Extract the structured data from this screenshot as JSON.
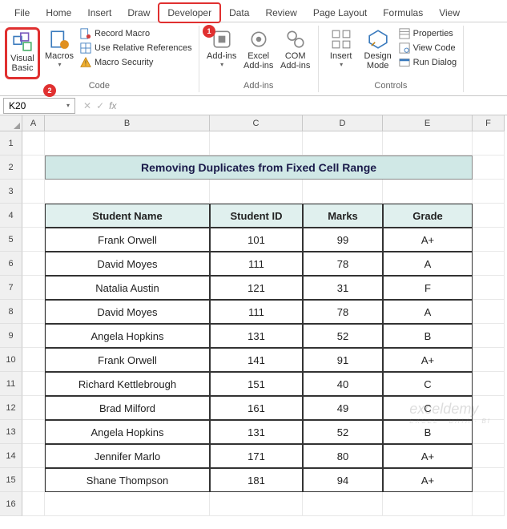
{
  "tabs": [
    "File",
    "Home",
    "Insert",
    "Draw",
    "Developer",
    "Data",
    "Review",
    "Page Layout",
    "Formulas",
    "View"
  ],
  "active_tab_index": 4,
  "ribbon": {
    "code": {
      "label": "Code",
      "visual_basic": "Visual Basic",
      "macros": "Macros",
      "record_macro": "Record Macro",
      "use_rel_refs": "Use Relative References",
      "macro_security": "Macro Security"
    },
    "addins": {
      "label": "Add-ins",
      "addins": "Add-ins",
      "excel_addins": "Excel Add-ins",
      "com_addins": "COM Add-ins"
    },
    "controls": {
      "label": "Controls",
      "insert": "Insert",
      "design_mode": "Design Mode",
      "properties": "Properties",
      "view_code": "View Code",
      "run_dialog": "Run Dialog"
    }
  },
  "namebox": "K20",
  "fx_label": "fx",
  "col_headers": [
    "A",
    "B",
    "C",
    "D",
    "E",
    "F"
  ],
  "row_headers": [
    "1",
    "2",
    "3",
    "4",
    "5",
    "6",
    "7",
    "8",
    "9",
    "10",
    "11",
    "12",
    "13",
    "14",
    "15",
    "16"
  ],
  "title": "Removing Duplicates from Fixed Cell Range",
  "table": {
    "headers": [
      "Student Name",
      "Student ID",
      "Marks",
      "Grade"
    ],
    "rows": [
      [
        "Frank Orwell",
        "101",
        "99",
        "A+"
      ],
      [
        "David Moyes",
        "111",
        "78",
        "A"
      ],
      [
        "Natalia Austin",
        "121",
        "31",
        "F"
      ],
      [
        "David Moyes",
        "111",
        "78",
        "A"
      ],
      [
        "Angela Hopkins",
        "131",
        "52",
        "B"
      ],
      [
        "Frank Orwell",
        "141",
        "91",
        "A+"
      ],
      [
        "Richard Kettlebrough",
        "151",
        "40",
        "C"
      ],
      [
        "Brad Milford",
        "161",
        "49",
        "C"
      ],
      [
        "Angela Hopkins",
        "131",
        "52",
        "B"
      ],
      [
        "Jennifer Marlo",
        "171",
        "80",
        "A+"
      ],
      [
        "Shane Thompson",
        "181",
        "94",
        "A+"
      ]
    ]
  },
  "callouts": {
    "c1": "1",
    "c2": "2"
  },
  "watermark": {
    "main": "exceldemy",
    "sub": "EXCEL · DATA · BI"
  }
}
